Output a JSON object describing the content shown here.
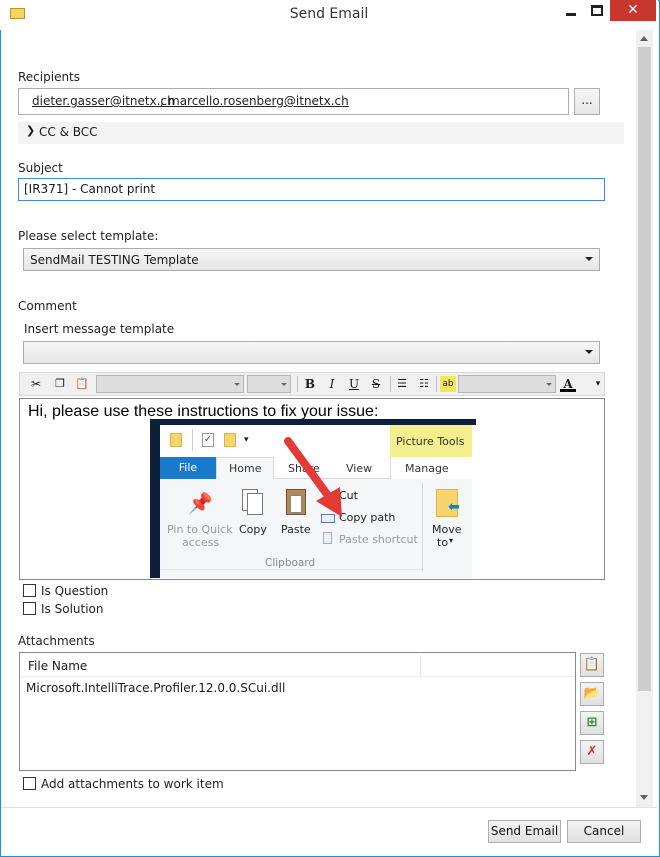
{
  "window": {
    "title": "Send Email"
  },
  "recipients": {
    "label": "Recipients",
    "list": [
      "dieter.gasser@itnetx.ch",
      "marcello.rosenberg@itnetx.ch"
    ],
    "separator": ";",
    "browse_label": "..."
  },
  "cc_bcc": {
    "label": "CC & BCC"
  },
  "subject": {
    "label": "Subject",
    "value": "[IR371] - Cannot print"
  },
  "template": {
    "label": "Please select template:",
    "selected": "SendMail TESTING Template"
  },
  "comment": {
    "label": "Comment",
    "insert_label": "Insert message template",
    "insert_selected": "",
    "body_text": "Hi, please use these instructions to fix your issue:"
  },
  "toolbar": {
    "bold": "B",
    "italic": "I",
    "underline": "U",
    "strike": "S",
    "color_letter": "A"
  },
  "embedded_image": {
    "context_tab": "Picture Tools",
    "tabs": [
      "File",
      "Home",
      "Share",
      "View",
      "Manage"
    ],
    "pin_label_1": "Pin to Quick",
    "pin_label_2": "access",
    "copy_label": "Copy",
    "paste_label": "Paste",
    "cut_label": "Cut",
    "copy_path_label": "Copy path",
    "paste_shortcut_label": "Paste shortcut",
    "move_label_1": "Move",
    "move_label_2": "to",
    "group_label": "Clipboard"
  },
  "options": {
    "is_question": "Is Question",
    "is_solution": "Is Solution"
  },
  "attachments": {
    "label": "Attachments",
    "column": "File Name",
    "files": [
      "Microsoft.IntelliTrace.Profiler.12.0.0.SCui.dll"
    ],
    "add_to_work_item": "Add attachments to work item"
  },
  "buttons": {
    "send": "Send Email",
    "cancel": "Cancel"
  },
  "colors": {
    "accent": "#1e8fd8",
    "close": "#c7372e",
    "file_tab": "#1979ca",
    "picture_tools": "#f3ef8f",
    "arrow": "#e53935"
  }
}
